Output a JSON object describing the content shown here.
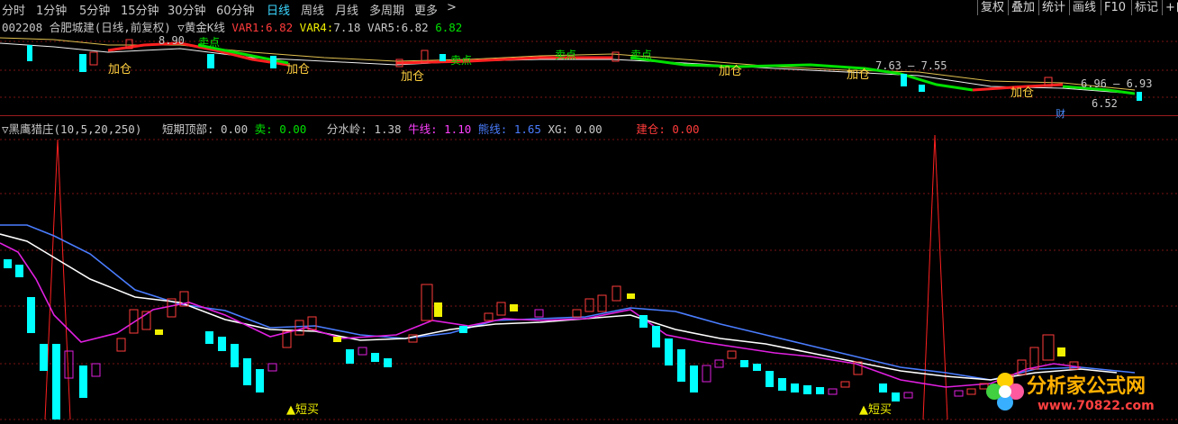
{
  "toolbar": {
    "periods": [
      "分时",
      "1分钟",
      "5分钟",
      "15分钟",
      "30分钟",
      "60分钟",
      "日线",
      "周线",
      "月线",
      "多周期",
      "更多"
    ],
    "more_arrow": ">",
    "active_period": "日线",
    "right_buttons": [
      "复权",
      "叠加",
      "统计",
      "画线",
      "F10",
      "标记"
    ],
    "right_extra": "+自"
  },
  "main_chart": {
    "code": "002208",
    "name": "合肥城建(日线,前复权)",
    "indicator": "▽黄金K线",
    "var1_label": "VAR1:",
    "var1": "6.82",
    "var4_label": "VAR4:",
    "var4": "7.18",
    "var5_label": "VAR5:",
    "var5": "6.82",
    "var6": "6.82",
    "annotations": {
      "add": "加仓",
      "sell": "卖点",
      "high_label": "8.90",
      "mid_label": "7.63 — 7.55",
      "right_label": "6.96 — 6.93",
      "low_label": "6.52",
      "cai": "财"
    }
  },
  "sub_chart": {
    "title": "▽黑鹰猎庄(10,5,20,250)",
    "short_top_label": "短期顶部:",
    "short_top": "0.00",
    "sell_label": "卖:",
    "sell": "0.00",
    "watershed_label": "分水岭:",
    "watershed": "1.38",
    "bull_label": "牛线:",
    "bull": "1.10",
    "bear_label": "熊线:",
    "bear": "1.65",
    "xg_label": "XG:",
    "xg": "0.00",
    "build_label": "建仓:",
    "build": "0.00",
    "signal": "▲短买"
  },
  "watermark": {
    "text": "分析家公式网",
    "url": "www.70822.com"
  },
  "colors": {
    "up": "#ff3b3b",
    "down": "#00ffff",
    "ma_green": "#00e000",
    "bull": "#ff40ff",
    "bear": "#4a7dff"
  }
}
